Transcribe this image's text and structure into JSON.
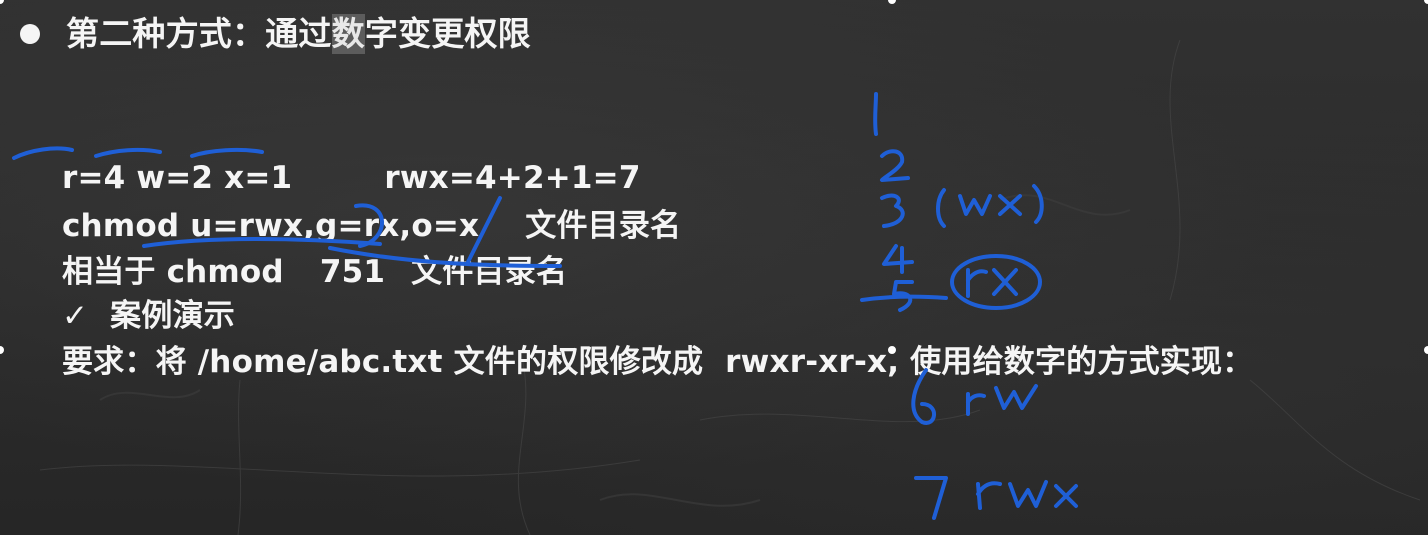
{
  "slide": {
    "title_before": "第二种方式：通过",
    "title_highlight": "数",
    "title_after": "字变更权限",
    "line1_part1": "r=4 w=2 x=1",
    "line1_part2": "rwx=4+2+1=7",
    "line2_part1": "chmod u=rwx,g=rx,o=x",
    "line2_part2": "文件目录名",
    "line3_prefix": "相当于 ",
    "line3_cmd": "chmod",
    "line3_num": "751",
    "line3_target": "文件目录名",
    "check_mark": "✓",
    "subheading": "案例演示",
    "requirement": "要求：将 /home/abc.txt 文件的权限修改成  rwxr-xr-x, 使用给数字的方式实现："
  },
  "handwriting": {
    "ink_color": "#1f5fd6",
    "notes": [
      "1",
      "2",
      "3",
      "(wx)",
      "4",
      "5",
      "rx",
      "6",
      "rw",
      "7",
      "rwx"
    ]
  }
}
